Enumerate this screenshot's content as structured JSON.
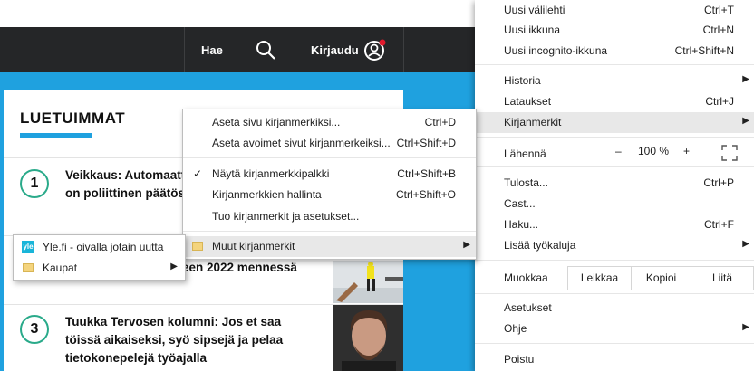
{
  "site": {
    "search_label": "Hae",
    "login_label": "Kirjaudu",
    "section_title": "LUETUIMMAT",
    "articles": [
      {
        "rank": "1",
        "line1": "Veikkaus: Automaattien",
        "line2": "on poliittinen päätös",
        "line3": ""
      },
      {
        "rank": "",
        "line1": "een 2022 mennessä",
        "line2": "",
        "line3": ""
      },
      {
        "rank": "3",
        "line1": "Tuukka Tervosen kolumni: Jos et saa",
        "line2": "töissä aikaiseksi, syö sipsejä ja pelaa",
        "line3": "tietokonepelejä työajalla"
      }
    ],
    "colors": {
      "header": "#252628",
      "accent": "#1fa1df",
      "circle": "#2aaa8a",
      "notification": "#e2192c"
    }
  },
  "chrome_menu": {
    "new_tab": {
      "label": "Uusi välilehti",
      "shortcut": "Ctrl+T"
    },
    "new_window": {
      "label": "Uusi ikkuna",
      "shortcut": "Ctrl+N"
    },
    "incognito": {
      "label": "Uusi incognito-ikkuna",
      "shortcut": "Ctrl+Shift+N"
    },
    "history": {
      "label": "Historia"
    },
    "downloads": {
      "label": "Lataukset",
      "shortcut": "Ctrl+J"
    },
    "bookmarks": {
      "label": "Kirjanmerkit"
    },
    "zoom": {
      "label": "Lähennä",
      "minus": "–",
      "value": "100 %",
      "plus": "+"
    },
    "print": {
      "label": "Tulosta...",
      "shortcut": "Ctrl+P"
    },
    "cast": {
      "label": "Cast..."
    },
    "find": {
      "label": "Haku...",
      "shortcut": "Ctrl+F"
    },
    "more_tools": {
      "label": "Lisää työkaluja"
    },
    "edit": {
      "label": "Muokkaa",
      "cut": "Leikkaa",
      "copy": "Kopioi",
      "paste": "Liitä"
    },
    "settings": {
      "label": "Asetukset"
    },
    "help": {
      "label": "Ohje"
    },
    "exit": {
      "label": "Poistu"
    }
  },
  "bookmarks_menu": {
    "bookmark_page": {
      "label": "Aseta sivu kirjanmerkiksi...",
      "shortcut": "Ctrl+D"
    },
    "bookmark_all": {
      "label": "Aseta avoimet sivut kirjanmerkeiksi...",
      "shortcut": "Ctrl+Shift+D"
    },
    "show_bar": {
      "label": "Näytä kirjanmerkkipalkki",
      "shortcut": "Ctrl+Shift+B",
      "check": "✓"
    },
    "manager": {
      "label": "Kirjanmerkkien hallinta",
      "shortcut": "Ctrl+Shift+O"
    },
    "import": {
      "label": "Tuo kirjanmerkit ja asetukset..."
    },
    "other": {
      "label": "Muut kirjanmerkit"
    }
  },
  "other_bookmarks": {
    "items": [
      {
        "label": "Yle.fi - oivalla jotain uutta",
        "icon_text": "yle"
      },
      {
        "label": "Kaupat"
      }
    ]
  }
}
